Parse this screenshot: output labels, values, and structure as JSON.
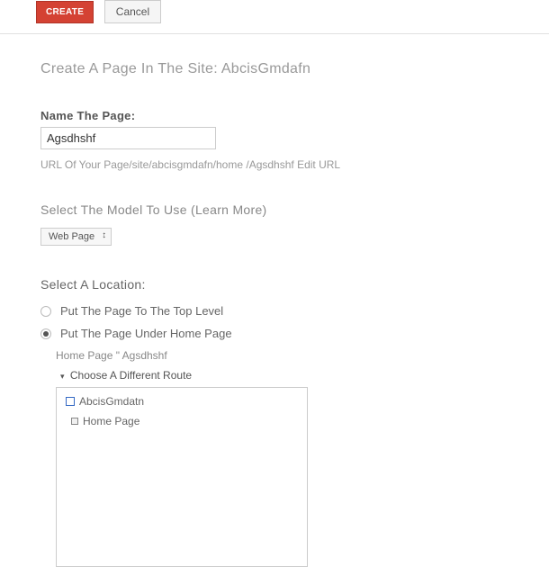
{
  "toolbar": {
    "create_label": "CREATE",
    "cancel_label": "Cancel"
  },
  "title": "Create A Page In The Site: AbcisGmdafn",
  "name_section": {
    "label": "Name The Page:",
    "value": "Agsdhshf",
    "url_prefix": "URL Of Your Page/site/abcisgmdafn/home /",
    "url_slug": "Agsdhshf",
    "edit_url": "Edit URL"
  },
  "model_section": {
    "label": "Select The Model To Use (Learn More)",
    "selected": "Web Page"
  },
  "location_section": {
    "label": "Select A Location:",
    "options": [
      {
        "label": "Put The Page To The Top Level",
        "checked": false
      },
      {
        "label": "Put The Page Under Home Page",
        "checked": true
      }
    ],
    "breadcrumb": "Home Page \" Agsdhshf",
    "choose_route": "Choose A Different Route",
    "tree": {
      "site": "AbcisGmdatn",
      "page": "Home Page"
    }
  }
}
